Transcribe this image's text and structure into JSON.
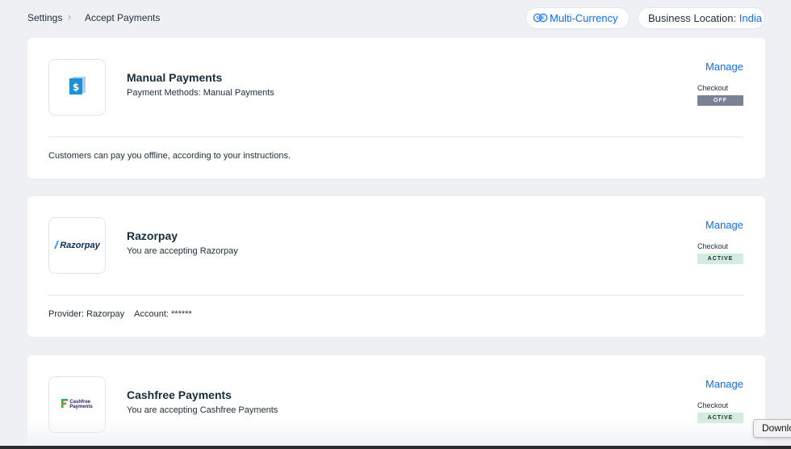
{
  "breadcrumb": {
    "settings": "Settings",
    "separator": "›",
    "current": "Accept Payments"
  },
  "header": {
    "multi_currency": "Multi-Currency",
    "business_location_label": "Business Location:",
    "business_location_value": "India"
  },
  "cards": [
    {
      "title": "Manual Payments",
      "subtitle": "Payment Methods: Manual Payments",
      "manage": "Manage",
      "checkout_label": "Checkout",
      "status": "OFF",
      "footer": "Customers can pay you offline, according to your instructions.",
      "icon": "dollar-document-icon"
    },
    {
      "title": "Razorpay",
      "subtitle": "You are accepting Razorpay",
      "manage": "Manage",
      "checkout_label": "Checkout",
      "status": "ACTIVE",
      "footer_provider": "Provider: Razorpay",
      "footer_account": "Account: ******",
      "logo_text": "Razorpay"
    },
    {
      "title": "Cashfree Payments",
      "subtitle": "You are accepting Cashfree Payments",
      "manage": "Manage",
      "checkout_label": "Checkout",
      "status": "ACTIVE",
      "logo_text_line1": "Cashfree",
      "logo_text_line2": "Payments"
    }
  ],
  "tooltip": {
    "download": "Download"
  },
  "colors": {
    "accent": "#116dff",
    "status_off": "#7a8294",
    "status_active": "#d3ecdd",
    "background": "#eef0f3"
  }
}
